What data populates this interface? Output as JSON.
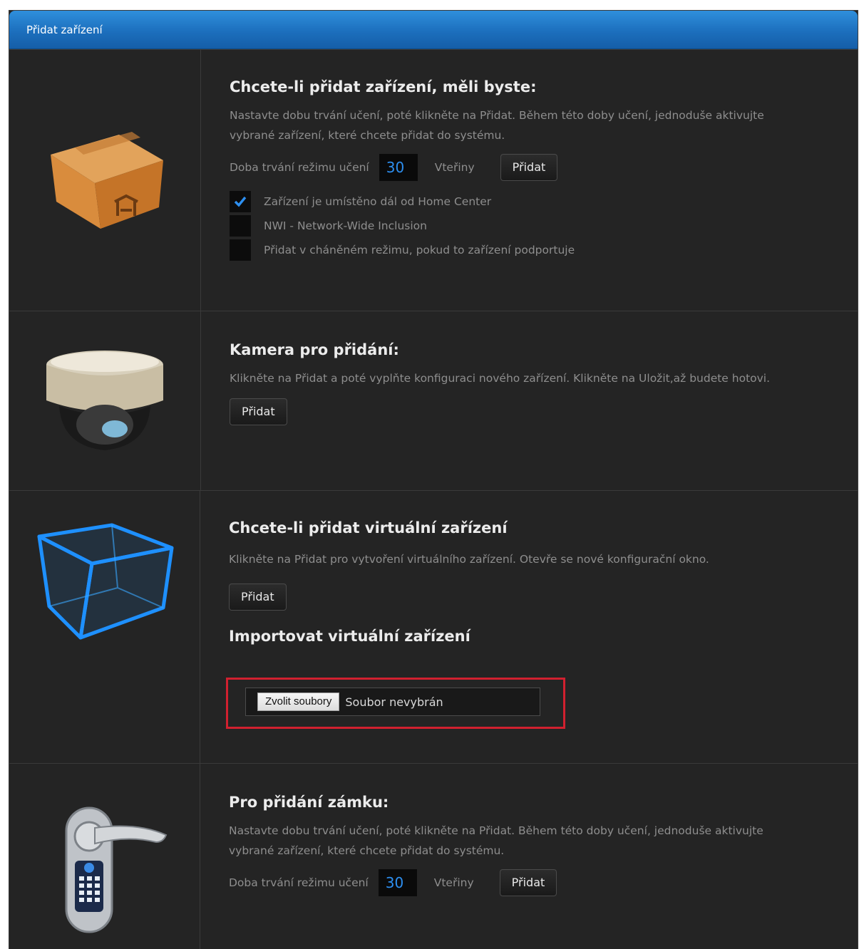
{
  "header": {
    "title": "Přidat zařízení"
  },
  "sections": {
    "standard": {
      "icon": "package-box-icon",
      "heading": "Chcete-li přidat zařízení, měli byste:",
      "description": "Nastavte dobu trvání učení, poté klikněte na Přidat. Během této doby učení, jednoduše aktivujte vybrané zařízení, které chcete přidat do systému.",
      "duration_label": "Doba trvání režimu učení",
      "duration_value": "30",
      "unit_label": "Vteřiny",
      "add_label": "Přidat",
      "options": [
        {
          "label": "Zařízení je umístěno dál od Home Center",
          "checked": true
        },
        {
          "label": "NWI - Network-Wide Inclusion",
          "checked": false
        },
        {
          "label": "Přidat v cháněném režimu, pokud to zařízení podportuje",
          "checked": false
        }
      ]
    },
    "camera": {
      "icon": "dome-camera-icon",
      "heading": "Kamera pro přidání:",
      "description": "Klikněte na Přidat a poté vyplňte konfiguraci nového zařízení. Klikněte na Uložit,až budete hotovi.",
      "add_label": "Přidat"
    },
    "virtual": {
      "icon": "virtual-cube-icon",
      "heading": "Chcete-li přidat virtuální zařízení",
      "description": "Klikněte na Přidat pro vytvoření virtuálního zařízení. Otevře se nové konfigurační okno.",
      "add_label": "Přidat",
      "import_heading": "Importovat virtuální zařízení",
      "file_button_label": "Zvolit soubory",
      "file_status": "Soubor nevybrán",
      "highlight_color": "#d1202f"
    },
    "lock": {
      "icon": "door-lock-icon",
      "heading": "Pro přidání zámku:",
      "description": "Nastavte dobu trvání učení, poté klikněte na Přidat. Během této doby učení, jednoduše aktivujte vybrané zařízení, které chcete přidat do systému.",
      "duration_label": "Doba trvání režimu učení",
      "duration_value": "30",
      "unit_label": "Vteřiny",
      "add_label": "Přidat"
    }
  },
  "colors": {
    "header_blue": "#1c6fbd",
    "panel_bg": "#242424",
    "field_text": "#2d8ff0",
    "checkmark": "#2d8ff0"
  }
}
